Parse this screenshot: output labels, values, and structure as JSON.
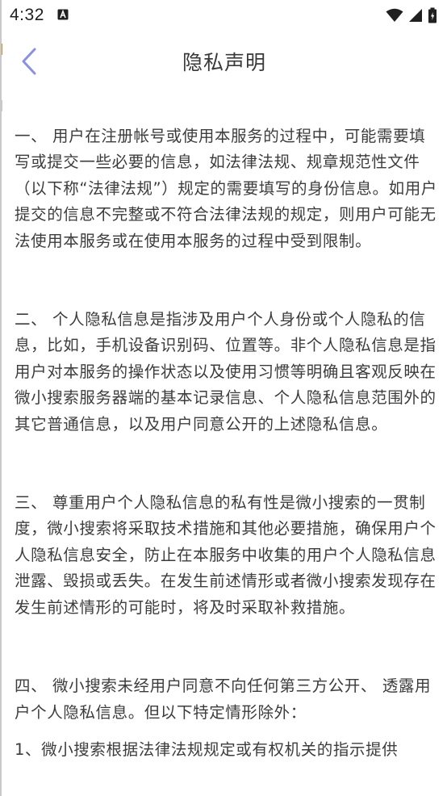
{
  "status_bar": {
    "time": "4:32",
    "notification_icon": "a-letter-icon",
    "icons": [
      "wifi-icon",
      "signal-icon",
      "battery-icon"
    ]
  },
  "header": {
    "title": "隐私声明",
    "back_icon": "chevron-left-icon"
  },
  "colors": {
    "accent": "#8c8fe8",
    "text": "#3c3c3c",
    "background": "#ffffff"
  },
  "content": {
    "paragraphs": [
      "一、 用户在注册帐号或使用本服务的过程中，可能需要填写或提交一些必要的信息，如法律法规、规章规范性文件（以下称“法律法规”）规定的需要填写的身份信息。如用户提交的信息不完整或不符合法律法规的规定，则用户可能无法使用本服务或在使用本服务的过程中受到限制。",
      "二、 个人隐私信息是指涉及用户个人身份或个人隐私的信息，比如，手机设备识别码、位置等。非个人隐私信息是指用户对本服务的操作状态以及使用习惯等明确且客观反映在微小搜索服务器端的基本记录信息、个人隐私信息范围外的其它普通信息，以及用户同意公开的上述隐私信息。",
      "三、 尊重用户个人隐私信息的私有性是微小搜索的一贯制度，微小搜索将采取技术措施和其他必要措施，确保用户个人隐私信息安全，防止在本服务中收集的用户个人隐私信息泄露、毁损或丢失。在发生前述情形或者微小搜索发现存在发生前述情形的可能时，将及时采取补救措施。",
      "四、 微小搜索未经用户同意不向任何第三方公开、 透露用户个人隐私信息。但以下特定情形除外：",
      "1、微小搜索根据法律法规规定或有权机关的指示提供"
    ]
  }
}
